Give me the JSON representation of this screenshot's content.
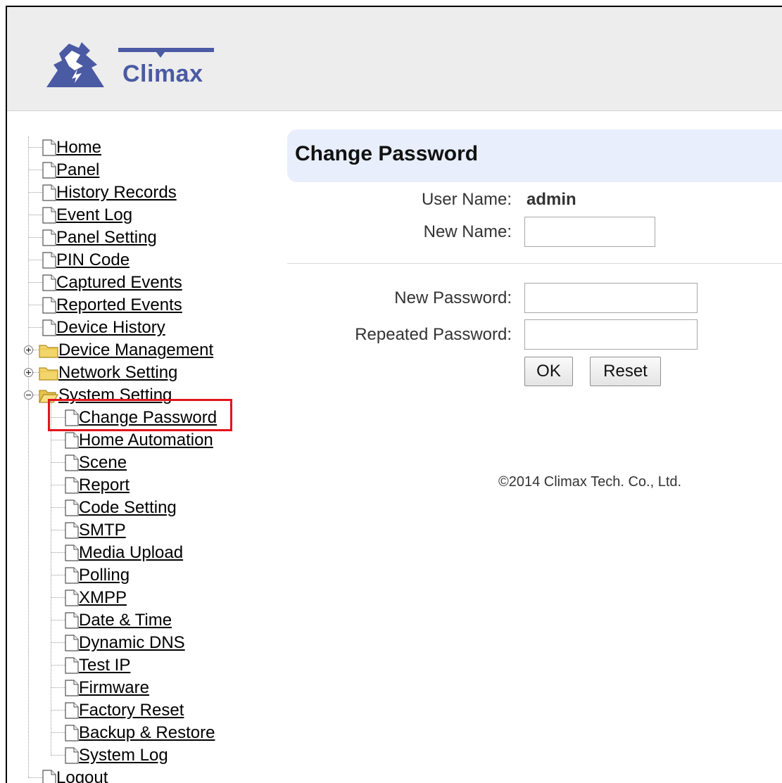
{
  "brand": {
    "name": "Climax",
    "color": "#4a5aa3"
  },
  "nav": {
    "items": [
      {
        "label": "Home",
        "type": "page"
      },
      {
        "label": "Panel",
        "type": "page"
      },
      {
        "label": "History Records",
        "type": "page"
      },
      {
        "label": "Event Log",
        "type": "page"
      },
      {
        "label": "Panel Setting",
        "type": "page"
      },
      {
        "label": "PIN Code",
        "type": "page"
      },
      {
        "label": "Captured Events",
        "type": "page"
      },
      {
        "label": "Reported Events",
        "type": "page"
      },
      {
        "label": "Device History",
        "type": "page"
      },
      {
        "label": "Device Management",
        "type": "folder",
        "state": "collapsed"
      },
      {
        "label": "Network Setting",
        "type": "folder",
        "state": "collapsed"
      },
      {
        "label": "System Setting",
        "type": "folder",
        "state": "expanded"
      }
    ],
    "children": [
      {
        "label": "Change Password",
        "selected": true
      },
      {
        "label": "Home Automation"
      },
      {
        "label": "Scene"
      },
      {
        "label": "Report"
      },
      {
        "label": "Code Setting"
      },
      {
        "label": "SMTP"
      },
      {
        "label": "Media Upload"
      },
      {
        "label": "Polling"
      },
      {
        "label": "XMPP"
      },
      {
        "label": "Date & Time"
      },
      {
        "label": "Dynamic DNS"
      },
      {
        "label": "Test IP"
      },
      {
        "label": "Firmware"
      },
      {
        "label": "Factory Reset"
      },
      {
        "label": "Backup & Restore"
      },
      {
        "label": "System Log"
      }
    ],
    "tail": {
      "label": "Logout"
    },
    "highlight_color": "#e3141b"
  },
  "main": {
    "title": "Change Password",
    "user_name_label": "User Name:",
    "user_name_value": "admin",
    "new_name_label": "New Name:",
    "new_name_value": "",
    "new_password_label": "New Password:",
    "new_password_value": "",
    "repeated_password_label": "Repeated Password:",
    "repeated_password_value": "",
    "ok_label": "OK",
    "reset_label": "Reset"
  },
  "footer": {
    "copyright": "©2014 Climax Tech. Co., Ltd."
  }
}
